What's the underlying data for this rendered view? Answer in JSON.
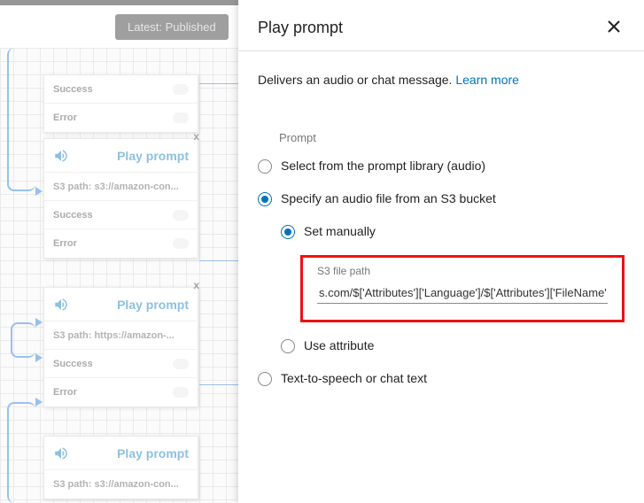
{
  "topbar": {
    "status": "Latest: Published"
  },
  "blocks": [
    {
      "rows": [
        {
          "text": "Success"
        },
        {
          "text": "Error"
        }
      ]
    },
    {
      "header": "Play prompt",
      "sub": "S3 path: s3://amazon-con...",
      "rows": [
        {
          "text": "Success"
        },
        {
          "text": "Error"
        }
      ]
    },
    {
      "header": "Play prompt",
      "sub": "S3 path: https://amazon-...",
      "rows": [
        {
          "text": "Success"
        },
        {
          "text": "Error"
        }
      ]
    },
    {
      "header": "Play prompt",
      "sub": "S3 path: s3://amazon-con..."
    }
  ],
  "panel": {
    "title": "Play prompt",
    "description": "Delivers an audio or chat message. ",
    "learn_more": "Learn more",
    "section_label": "Prompt",
    "options": {
      "library": "Select from the prompt library (audio)",
      "s3": "Specify an audio file from an S3 bucket",
      "set_manually": "Set manually",
      "s3_file_path_label": "S3 file path",
      "s3_file_path_value": "s.com/$['Attributes']['Language']/$['Attributes']['FileName']",
      "use_attribute": "Use attribute",
      "tts": "Text-to-speech or chat text"
    }
  }
}
